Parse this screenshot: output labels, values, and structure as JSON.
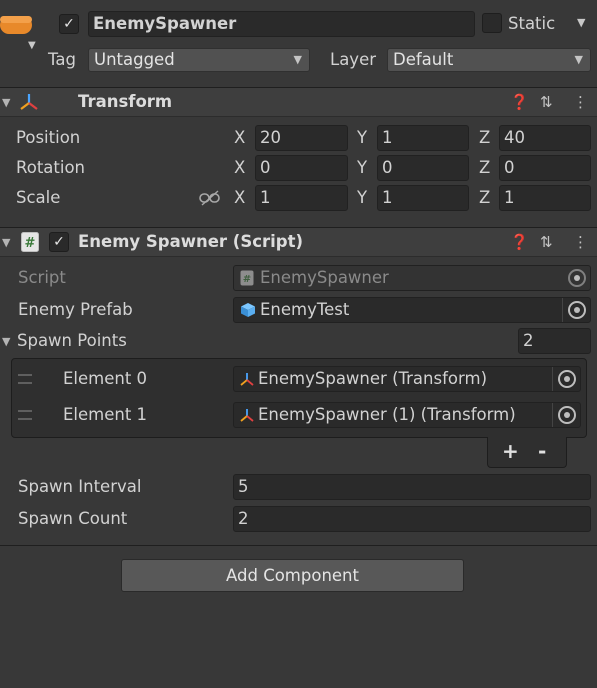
{
  "header": {
    "object_active": true,
    "object_name": "EnemySpawner",
    "static_label": "Static",
    "tag_label": "Tag",
    "tag_value": "Untagged",
    "layer_label": "Layer",
    "layer_value": "Default"
  },
  "transform": {
    "title": "Transform",
    "rows": [
      {
        "label": "Position",
        "x": "20",
        "y": "1",
        "z": "40"
      },
      {
        "label": "Rotation",
        "x": "0",
        "y": "0",
        "z": "0"
      },
      {
        "label": "Scale",
        "x": "1",
        "y": "1",
        "z": "1"
      }
    ],
    "axis_x": "X",
    "axis_y": "Y",
    "axis_z": "Z"
  },
  "spawner": {
    "title": "Enemy Spawner (Script)",
    "script_label": "Script",
    "script_value": "EnemySpawner",
    "prefab_label": "Enemy Prefab",
    "prefab_value": "EnemyTest",
    "spawn_points_label": "Spawn Points",
    "spawn_points_count": "2",
    "elements": [
      {
        "label": "Element 0",
        "value": "EnemySpawner (Transform)"
      },
      {
        "label": "Element 1",
        "value": "EnemySpawner (1) (Transform)"
      }
    ],
    "add_label": "+",
    "remove_label": "-",
    "interval_label": "Spawn Interval",
    "interval_value": "5",
    "count_label": "Spawn Count",
    "count_value": "2"
  },
  "add_component_label": "Add Component",
  "colors": {
    "background": "#383838",
    "field": "#2a2a2a",
    "header": "#3e3e3e",
    "accent_orange": "#e8892a"
  },
  "icons": [
    "cube-icon",
    "transform-icon",
    "script-icon",
    "prefab-icon",
    "help-icon",
    "preset-icon",
    "more-icon",
    "link-icon",
    "object-picker-icon",
    "drag-handle-icon"
  ]
}
